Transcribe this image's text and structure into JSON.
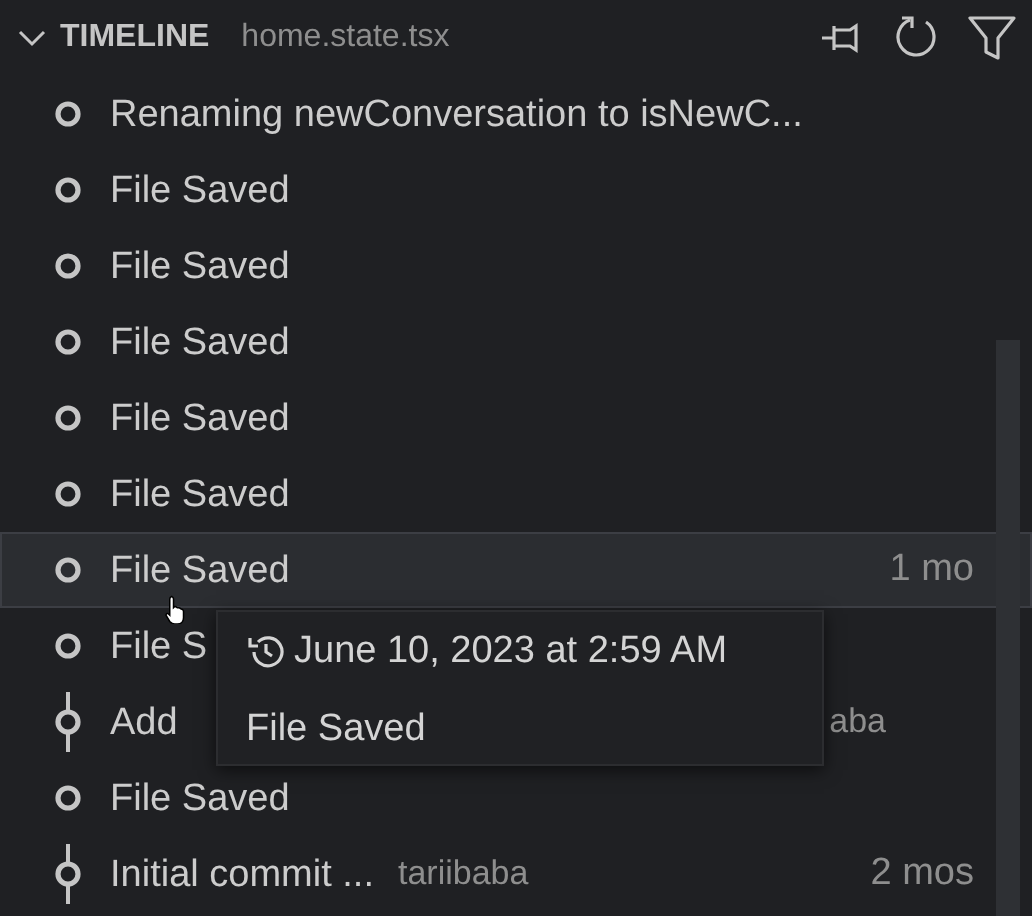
{
  "header": {
    "expanded": true,
    "title": "TIMELINE",
    "file": "home.state.tsx"
  },
  "rows": [
    {
      "kind": "file",
      "label": "Renaming newConversation to isNewC...",
      "selected": false
    },
    {
      "kind": "file",
      "label": "File Saved",
      "selected": false
    },
    {
      "kind": "file",
      "label": "File Saved",
      "selected": false
    },
    {
      "kind": "file",
      "label": "File Saved",
      "selected": false
    },
    {
      "kind": "file",
      "label": "File Saved",
      "selected": false
    },
    {
      "kind": "file",
      "label": "File Saved",
      "selected": false
    },
    {
      "kind": "file",
      "label": "File Saved",
      "time": "1 mo",
      "selected": true
    },
    {
      "kind": "file",
      "label": "File S",
      "selected": false
    },
    {
      "kind": "commit",
      "label": "Add",
      "author": "aba",
      "selected": false
    },
    {
      "kind": "file",
      "label": "File Saved",
      "selected": false
    },
    {
      "kind": "commit",
      "label": "Initial commit ...",
      "author": "tariibaba",
      "time": "2 mos",
      "selected": false
    }
  ],
  "tooltip": {
    "date": "June 10, 2023 at 2:59 AM",
    "message": "File Saved"
  }
}
